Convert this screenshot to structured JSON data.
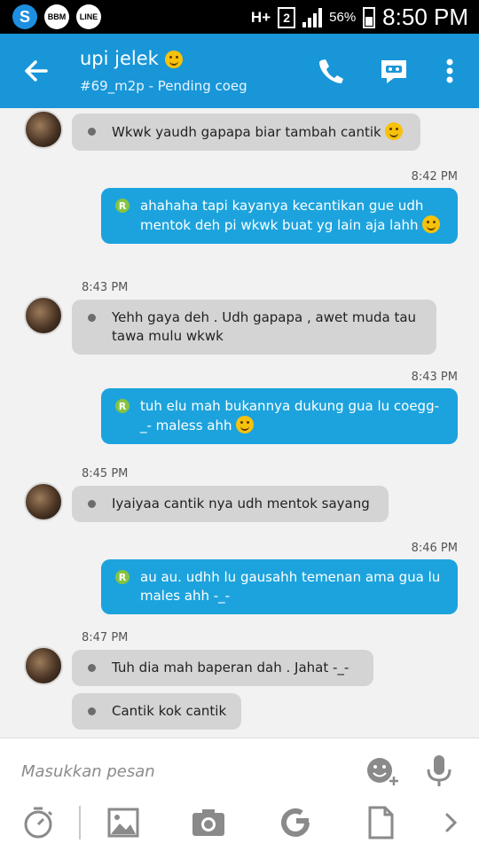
{
  "status_bar": {
    "apps": [
      "S",
      "BBM",
      "LINE"
    ],
    "network": "H+",
    "sim": "2",
    "battery_percent": "56%",
    "time": "8:50 PM"
  },
  "header": {
    "title": "upi jelek",
    "subtitle": "#69_m2p - Pending coeg",
    "icons": [
      "back-arrow-icon",
      "phone-icon",
      "video-chat-icon",
      "more-vert-icon"
    ]
  },
  "messages": [
    {
      "direction": "in",
      "text": "Wkwk yaudh gapapa biar tambah cantik",
      "emoji": true
    },
    {
      "direction": "out",
      "time": "8:42 PM",
      "text": "ahahaha tapi kayanya kecantikan gue udh mentok deh pi wkwk buat yg lain aja lahh",
      "emoji": true,
      "badge": "R"
    },
    {
      "direction": "in",
      "time": "8:43 PM",
      "text": "Yehh gaya deh . Udh gapapa , awet muda tau tawa mulu wkwk"
    },
    {
      "direction": "out",
      "time": "8:43 PM",
      "text": "tuh elu mah bukannya dukung gua lu coegg-_- maless ahh",
      "emoji": true,
      "badge": "R"
    },
    {
      "direction": "in",
      "time": "8:45 PM",
      "text": "Iyaiyaa cantik nya udh mentok sayang"
    },
    {
      "direction": "out",
      "time": "8:46 PM",
      "text": "au au. udhh lu gausahh temenan ama gua lu males ahh -_-",
      "badge": "R"
    },
    {
      "direction": "in",
      "time": "8:47 PM",
      "text": "Tuh dia mah baperan dah . Jahat -_-"
    },
    {
      "direction": "in",
      "text": "Cantik kok cantik"
    }
  ],
  "input": {
    "placeholder": "Masukkan pesan"
  },
  "toolbar": {
    "icons": [
      "timer-icon",
      "image-icon",
      "camera-icon",
      "refresh-icon",
      "file-icon",
      "chevron-right-icon"
    ]
  },
  "colors": {
    "header": "#1896d8",
    "outgoing_bubble": "#1ca3dd",
    "incoming_bubble": "#d4d4d4",
    "read_badge": "#86c440"
  }
}
